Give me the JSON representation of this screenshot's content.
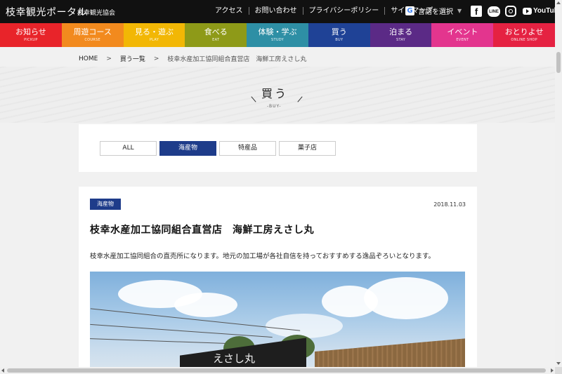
{
  "header": {
    "site_title": "枝幸観光ポータル",
    "site_sub": "枝幸観光協会",
    "links": [
      "アクセス",
      "お問い合わせ",
      "プライバシーポリシー",
      "サイトマップ"
    ],
    "language": "言語を選択",
    "google_glyph": "G",
    "social": {
      "facebook": "f",
      "line": "LINE",
      "youtube": "YouTube"
    }
  },
  "nav": [
    {
      "label": "お知らせ",
      "sub": "PICKUP",
      "color": "#e8242a"
    },
    {
      "label": "周遊コース",
      "sub": "COURSE",
      "color": "#f28a1e"
    },
    {
      "label": "見る・遊ぶ",
      "sub": "PLAY",
      "color": "#f2b705"
    },
    {
      "label": "食べる",
      "sub": "EAT",
      "color": "#8e9a18"
    },
    {
      "label": "体験・学ぶ",
      "sub": "STUDY",
      "color": "#2e8fa5"
    },
    {
      "label": "買う",
      "sub": "BUY",
      "color": "#1f4296"
    },
    {
      "label": "泊まる",
      "sub": "STAY",
      "color": "#5b2a86"
    },
    {
      "label": "イベント",
      "sub": "EVENT",
      "color": "#e3358e"
    },
    {
      "label": "おとりよせ",
      "sub": "ONLINE SHOP",
      "color": "#e52242"
    }
  ],
  "breadcrumb": {
    "home": "HOME",
    "sep": ">",
    "category": "買う一覧",
    "current": "枝幸水産加工協同組合直営店　海鮮工房えさし丸"
  },
  "hero": {
    "title": "買う",
    "sub": "-BUY-"
  },
  "filters": [
    {
      "label": "ALL",
      "active": false
    },
    {
      "label": "海産物",
      "active": true
    },
    {
      "label": "特産品",
      "active": false
    },
    {
      "label": "菓子店",
      "active": false
    }
  ],
  "article": {
    "tag": "海産物",
    "date": "2018.11.03",
    "title": "枝幸水産加工協同組合直営店　海鮮工房えさし丸",
    "description": "枝幸水産加工協同組合の直売所になります。地元の加工場が各社自信を持っておすすめする逸品ぞろいとなります。",
    "photo_sign": "えさし丸"
  }
}
